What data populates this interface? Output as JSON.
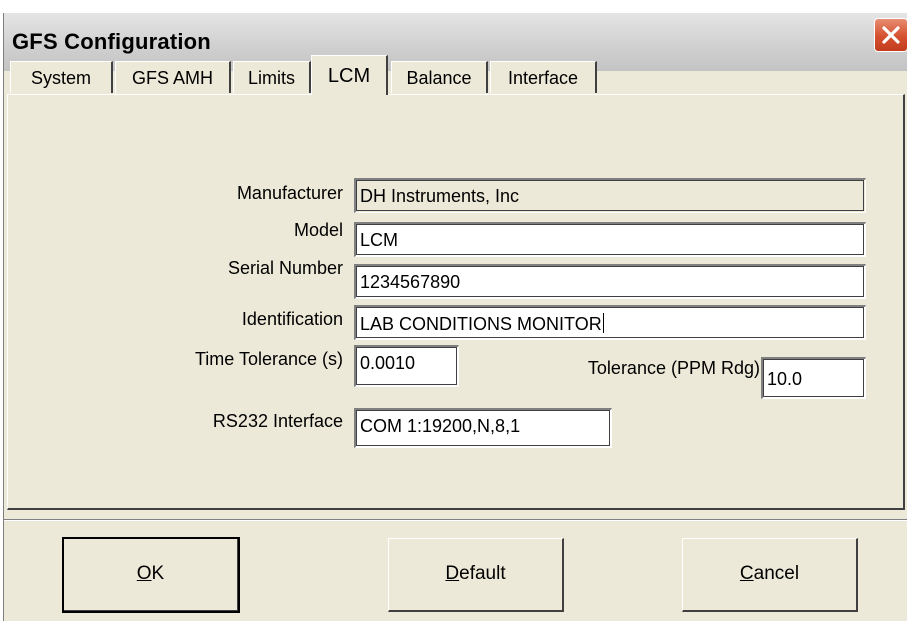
{
  "window": {
    "title": "GFS Configuration",
    "close_icon": "close-x-icon"
  },
  "tabs": [
    {
      "label": "System",
      "active": false
    },
    {
      "label": "GFS AMH",
      "active": false
    },
    {
      "label": "Limits",
      "active": false
    },
    {
      "label": "LCM",
      "active": true
    },
    {
      "label": "Balance",
      "active": false
    },
    {
      "label": "Interface",
      "active": false
    }
  ],
  "form": {
    "manufacturer": {
      "label": "Manufacturer",
      "value": "DH Instruments, Inc"
    },
    "model": {
      "label": "Model",
      "value": "LCM"
    },
    "serial_number": {
      "label": "Serial Number",
      "value": "1234567890"
    },
    "identification": {
      "label": "Identification",
      "value": "LAB CONDITIONS MONITOR"
    },
    "time_tolerance": {
      "label": "Time Tolerance (s)",
      "value": "0.0010"
    },
    "tolerance_ppm": {
      "label": "Tolerance (PPM Rdg)",
      "value": "10.0"
    },
    "rs232": {
      "label": "RS232 Interface",
      "value": "COM 1:19200,N,8,1"
    }
  },
  "buttons": {
    "ok": {
      "mnemonic": "O",
      "rest": "K"
    },
    "default": {
      "mnemonic": "D",
      "rest": "efault"
    },
    "cancel": {
      "mnemonic": "C",
      "rest": "ancel"
    }
  }
}
